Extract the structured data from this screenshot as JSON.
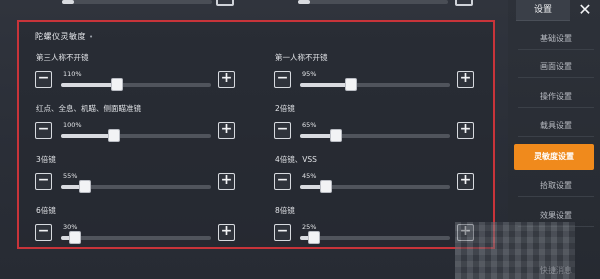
{
  "panel": {
    "title": "陀螺仪灵敏度",
    "cells": [
      {
        "label": "第三人称不开镜",
        "value_text": "110%",
        "fraction": 0.37
      },
      {
        "label": "第一人称不开镜",
        "value_text": "95%",
        "fraction": 0.34
      },
      {
        "label": "红点、全息、机瞄、侧面瞄准镜",
        "value_text": "100%",
        "fraction": 0.35
      },
      {
        "label": "2倍镜",
        "value_text": "65%",
        "fraction": 0.24
      },
      {
        "label": "3倍镜",
        "value_text": "55%",
        "fraction": 0.16
      },
      {
        "label": "4倍镜、VSS",
        "value_text": "45%",
        "fraction": 0.17
      },
      {
        "label": "6倍镜",
        "value_text": "30%",
        "fraction": 0.09
      },
      {
        "label": "8倍镜",
        "value_text": "25%",
        "fraction": 0.09
      }
    ],
    "minus": "−",
    "plus": "+"
  },
  "sidebar": {
    "title": "设置",
    "close": "✕",
    "items": [
      {
        "label": "基础设置",
        "active": false
      },
      {
        "label": "画面设置",
        "active": false
      },
      {
        "label": "操作设置",
        "active": false
      },
      {
        "label": "载具设置",
        "active": false
      },
      {
        "label": "灵敏度设置",
        "active": true
      },
      {
        "label": "拾取设置",
        "active": false
      },
      {
        "label": "效果设置",
        "active": false
      },
      {
        "label": "快捷消息",
        "active": false
      }
    ]
  },
  "colors": {
    "accent": "#f08a1c",
    "highlight_border": "#c8343a"
  }
}
